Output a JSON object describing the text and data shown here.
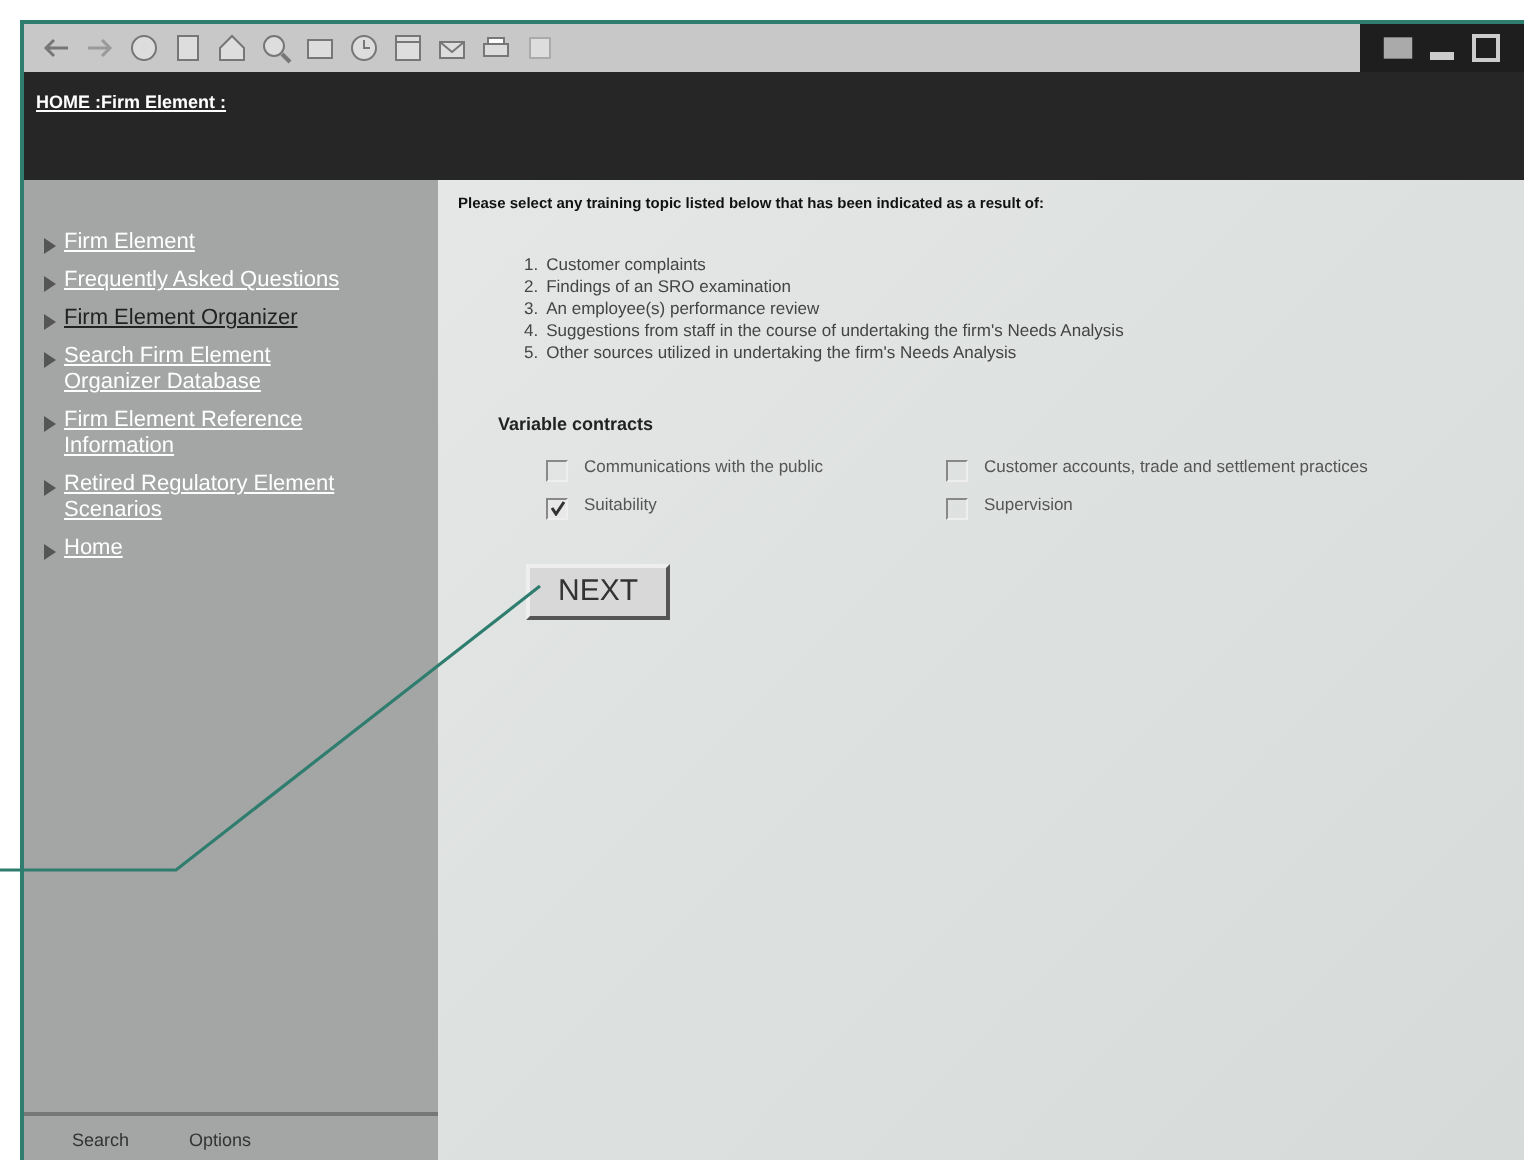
{
  "header": {
    "breadcrumb": "HOME :Firm Element :"
  },
  "sidebar": {
    "items": [
      {
        "label": "Firm Element",
        "selected": false
      },
      {
        "label": "Frequently Asked Questions",
        "selected": false
      },
      {
        "label": "Firm Element Organizer",
        "selected": true
      },
      {
        "label": "Search Firm Element Organizer Database",
        "selected": false
      },
      {
        "label": "Firm Element Reference Information",
        "selected": false
      },
      {
        "label": "Retired Regulatory Element Scenarios",
        "selected": false
      },
      {
        "label": "Home",
        "selected": false
      }
    ],
    "footer": [
      "Search",
      "Options"
    ]
  },
  "content": {
    "intro": "Please select any training topic listed below that has been indicated as a result of:",
    "reasons": [
      {
        "number": "1.",
        "text": "Customer complaints"
      },
      {
        "number": "2.",
        "text": "Findings of an SRO examination"
      },
      {
        "number": "3.",
        "text": "An employee(s) performance review"
      },
      {
        "number": "4.",
        "text": "Suggestions from staff in the course of undertaking the firm's Needs Analysis"
      },
      {
        "number": "5.",
        "text": "Other sources utilized in undertaking the firm's Needs Analysis"
      }
    ],
    "section_title": "Variable contracts",
    "topics": [
      {
        "label": "Communications with the public",
        "checked": false
      },
      {
        "label": "Customer accounts, trade and settlement practices",
        "checked": false
      },
      {
        "label": "Suitability",
        "checked": true
      },
      {
        "label": "Supervision",
        "checked": false
      }
    ],
    "next_button": "NEXT"
  }
}
